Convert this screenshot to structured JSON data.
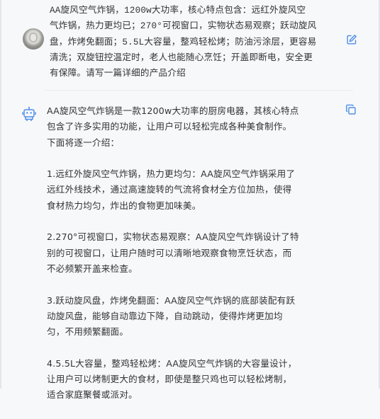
{
  "user_message": {
    "text": "AA旋风空气炸锅，1200w大功率，核心特点包含：远红外旋风空\n气炸锅，热力更均已；270°可视窗口，实物状态易观察；跃动旋风\n盘，炸烤免翻面；5.5L大容量，整鸡轻松烤；防油污涂层，更容易\n清洗；双旋钮控温定时，老人也能随心烹饪；开盖即断电，安全更\n有保障。请写一篇详细的产品介绍"
  },
  "assistant_message": {
    "paragraphs": [
      "AA旋风空气炸锅是一款1200w大功率的厨房电器，其核心特点\n包含了许多实用的功能，让用户可以轻松完成各种美食制作。\n下面将逐一介绍：",
      "1.远红外旋风空气炸锅，热力更均匀：AA旋风空气炸锅采用了\n远红外线技术，通过高速旋转的气流将食材全方位加热，使得\n食材热力均匀，炸出的食物更加味美。",
      "2.270°可视窗口，实物状态易观察：AA旋风空气炸锅设计了特\n别的可视窗口，让用户随时可以清晰地观察食物烹饪状态，而\n不必频繁开盖来检查。",
      "3.跃动旋风盘，炸烤免翻面：AA旋风空气炸锅的底部装配有跃\n动旋风盘，能够自动靠边下降，自动跳动，使得炸烤更加均\n匀，不用频繁翻面。",
      "4.5.5L大容量，整鸡轻松烤：AA旋风空气炸锅的大容量设计，\n让用户可以烤制更大的食材，即使是整只鸡也可以轻松烤制，\n适合家庭聚餐或派对。"
    ]
  },
  "icons": {
    "edit": "edit-icon",
    "copy": "copy-icon",
    "bot": "robot-icon",
    "avatar": "user-avatar"
  },
  "colors": {
    "accent": "#4e8ee9",
    "text": "#333333",
    "background": "#f7f8fa"
  }
}
